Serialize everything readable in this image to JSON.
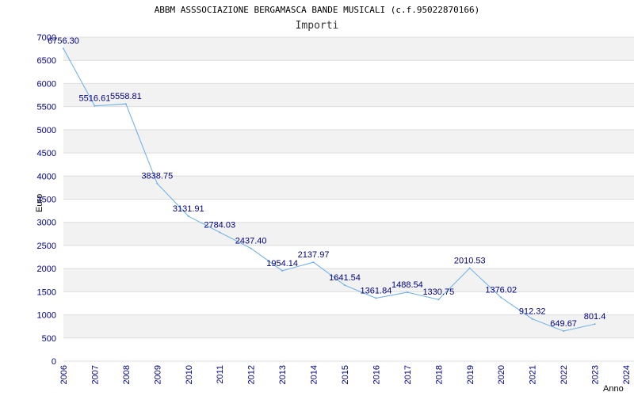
{
  "title": "ABBM ASSSOCIAZIONE BERGAMASCA BANDE MUSICALI (c.f.95022870166)",
  "subtitle": "Importi",
  "colors": {
    "line": "#6aaeea",
    "axis_text": "#00008b",
    "label_text": "#000080",
    "band": "#f2f2f2"
  },
  "chart_data": {
    "type": "line",
    "title": "ABBM ASSSOCIAZIONE BERGAMASCA BANDE MUSICALI (c.f.95022870166)",
    "subtitle": "Importi",
    "xlabel": "Anno",
    "ylabel": "Euro",
    "ylim": [
      0,
      7000
    ],
    "yticks": [
      0,
      500,
      1000,
      1500,
      2000,
      2500,
      3000,
      3500,
      4000,
      4500,
      5000,
      5500,
      6000,
      6500,
      7000
    ],
    "grid": true,
    "categories": [
      "2006",
      "2007",
      "2008",
      "2009",
      "2010",
      "2011",
      "2012",
      "2013",
      "2014",
      "2015",
      "2016",
      "2017",
      "2018",
      "2019",
      "2020",
      "2021",
      "2022",
      "2023",
      "2024"
    ],
    "values": [
      6756.3,
      5516.61,
      5558.81,
      3838.75,
      3131.91,
      2784.03,
      2437.4,
      1954.14,
      2137.97,
      1641.54,
      1361.84,
      1488.54,
      1330.75,
      2010.53,
      1376.02,
      912.32,
      649.67,
      801.4
    ],
    "value_labels": [
      "6756.30",
      "5516.61",
      "5558.81",
      "3838.75",
      "3131.91",
      "2784.03",
      "2437.40",
      "1954.14",
      "2137.97",
      "1641.54",
      "1361.84",
      "1488.54",
      "1330.75",
      "2010.53",
      "1376.02",
      "912.32",
      "649.67",
      "801.4"
    ]
  }
}
